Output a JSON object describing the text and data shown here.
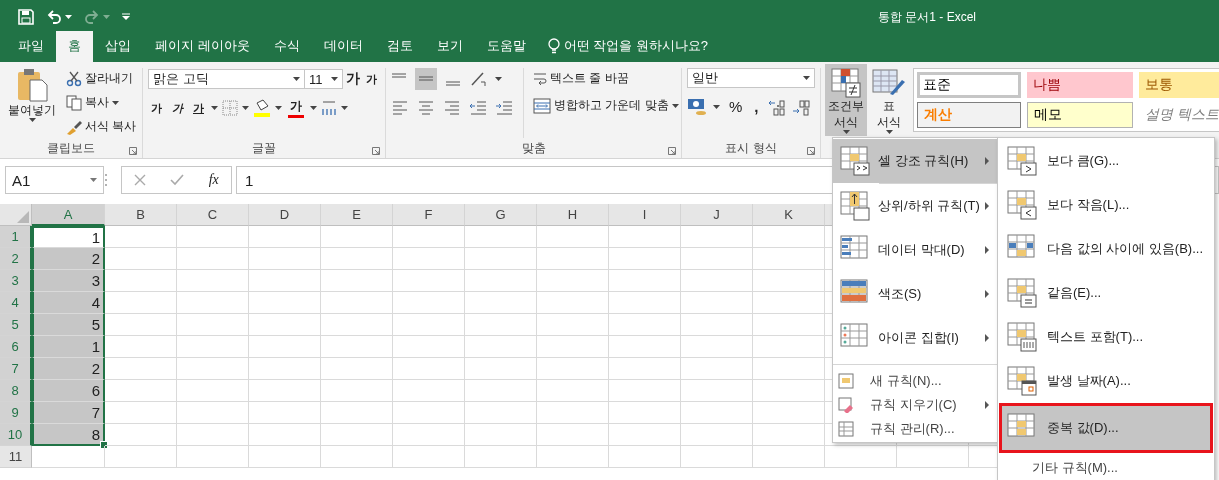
{
  "window": {
    "title": "통합 문서1  -  Excel"
  },
  "tabs": [
    {
      "label": "파일",
      "selected": false
    },
    {
      "label": "홈",
      "selected": true
    },
    {
      "label": "삽입",
      "selected": false
    },
    {
      "label": "페이지 레이아웃",
      "selected": false
    },
    {
      "label": "수식",
      "selected": false
    },
    {
      "label": "데이터",
      "selected": false
    },
    {
      "label": "검토",
      "selected": false
    },
    {
      "label": "보기",
      "selected": false
    },
    {
      "label": "도움말",
      "selected": false
    }
  ],
  "tell_me": "어떤 작업을 원하시나요?",
  "ribbon": {
    "clipboard": {
      "paste": "붙여넣기",
      "cut": "잘라내기",
      "copy": "복사",
      "format_painter": "서식 복사",
      "group_label": "클립보드"
    },
    "font": {
      "font_name": "맑은 고딕",
      "font_size": "11",
      "grow": "가",
      "shrink": "가",
      "bold": "가",
      "italic": "가",
      "underline": "가",
      "font_color": "가",
      "group_label": "글꼴"
    },
    "alignment": {
      "wrap_text": "텍스트 줄 바꿈",
      "merge_center": "병합하고 가운데 맞춤",
      "group_label": "맞춤"
    },
    "number": {
      "format": "일반",
      "percent": "%",
      "comma": ",",
      "group_label": "표시 형식"
    },
    "conditional_formatting": {
      "lines": [
        "조건부",
        "서식"
      ],
      "pressed": true
    },
    "format_as_table": {
      "lines": [
        "표",
        "서식"
      ],
      "pressed": false
    },
    "styles": [
      {
        "label": "표준",
        "kind": "normal",
        "selected": true
      },
      {
        "label": "나쁨",
        "kind": "bad",
        "selected": false
      },
      {
        "label": "보통",
        "kind": "neutral",
        "selected": false
      },
      {
        "label": "계산",
        "kind": "calculation",
        "selected": false
      },
      {
        "label": "메모",
        "kind": "note",
        "selected": false
      },
      {
        "label": "설명 텍스트",
        "kind": "explanatory",
        "selected": false
      }
    ]
  },
  "formula_bar": {
    "name_box": "A1",
    "fx": "fx",
    "value": "1"
  },
  "sheet": {
    "columns": [
      {
        "label": "A",
        "selected": true
      },
      {
        "label": "B",
        "selected": false
      },
      {
        "label": "C",
        "selected": false
      },
      {
        "label": "D",
        "selected": false
      },
      {
        "label": "E",
        "selected": false
      },
      {
        "label": "F",
        "selected": false
      },
      {
        "label": "G",
        "selected": false
      },
      {
        "label": "H",
        "selected": false
      },
      {
        "label": "I",
        "selected": false
      },
      {
        "label": "J",
        "selected": false
      },
      {
        "label": "K",
        "selected": false
      }
    ],
    "rows": [
      {
        "label": "1",
        "value": "1",
        "selected": true,
        "active": true
      },
      {
        "label": "2",
        "value": "2",
        "selected": true,
        "active": false
      },
      {
        "label": "3",
        "value": "3",
        "selected": true,
        "active": false
      },
      {
        "label": "4",
        "value": "4",
        "selected": true,
        "active": false
      },
      {
        "label": "5",
        "value": "5",
        "selected": true,
        "active": false
      },
      {
        "label": "6",
        "value": "1",
        "selected": true,
        "active": false
      },
      {
        "label": "7",
        "value": "2",
        "selected": true,
        "active": false
      },
      {
        "label": "8",
        "value": "6",
        "selected": true,
        "active": false
      },
      {
        "label": "9",
        "value": "7",
        "selected": true,
        "active": false
      },
      {
        "label": "10",
        "value": "8",
        "selected": true,
        "active": false
      },
      {
        "label": "11",
        "selected": false,
        "active": false
      }
    ]
  },
  "cf_menu": {
    "items": [
      {
        "label": "셀 강조 규칙(H)",
        "kind": "large",
        "submenu": true,
        "selected": true
      },
      {
        "label": "상위/하위 규칙(T)",
        "kind": "large",
        "submenu": true,
        "selected": false
      },
      {
        "label": "데이터 막대(D)",
        "kind": "large",
        "submenu": true,
        "selected": false
      },
      {
        "label": "색조(S)",
        "kind": "large",
        "submenu": true,
        "selected": false
      },
      {
        "label": "아이콘 집합(I)",
        "kind": "large",
        "submenu": true,
        "selected": false
      },
      {
        "label": "새 규칙(N)...",
        "kind": "small",
        "submenu": false,
        "selected": false
      },
      {
        "label": "규칙 지우기(C)",
        "kind": "small",
        "submenu": true,
        "selected": false
      },
      {
        "label": "규칙 관리(R)...",
        "kind": "small",
        "submenu": false,
        "selected": false
      }
    ]
  },
  "highlight_submenu": {
    "items": [
      {
        "label": "보다 큼(G)...",
        "selected": false,
        "outlined": false
      },
      {
        "label": "보다 작음(L)...",
        "selected": false,
        "outlined": false
      },
      {
        "label": "다음 값의 사이에 있음(B)...",
        "selected": false,
        "outlined": false
      },
      {
        "label": "같음(E)...",
        "selected": false,
        "outlined": false
      },
      {
        "label": "텍스트 포함(T)...",
        "selected": false,
        "outlined": false
      },
      {
        "label": "발생 날짜(A)...",
        "selected": false,
        "outlined": false
      },
      {
        "label": "중복 값(D)...",
        "selected": true,
        "outlined": true
      }
    ],
    "more": "기타 규칙(M)..."
  }
}
